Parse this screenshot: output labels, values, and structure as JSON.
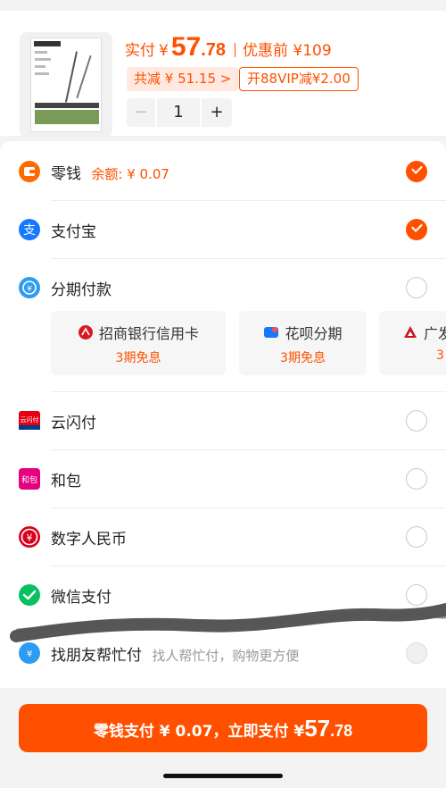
{
  "product": {
    "price_label": "实付",
    "currency": "¥",
    "price_int": "57",
    "price_dec": ".78",
    "original_label": "优惠前 ¥109",
    "discount_tag": "共减 ¥ 51.15 >",
    "vip_tag": "开88VIP减¥2.00",
    "quantity": "1",
    "minus": "−",
    "plus": "+"
  },
  "methods": [
    {
      "name": "零钱",
      "sub": "余额: ¥ 0.07",
      "checked": true,
      "icon": "wallet-icon"
    },
    {
      "name": "支付宝",
      "sub": "",
      "checked": true,
      "icon": "alipay-icon"
    },
    {
      "name": "分期付款",
      "sub": "",
      "checked": false,
      "icon": "installment-icon"
    },
    {
      "name": "云闪付",
      "sub": "",
      "checked": false,
      "icon": "unionpay-icon"
    },
    {
      "name": "和包",
      "sub": "",
      "checked": false,
      "icon": "hebao-icon"
    },
    {
      "name": "数字人民币",
      "sub": "",
      "checked": false,
      "icon": "ecny-icon"
    },
    {
      "name": "微信支付",
      "sub": "",
      "checked": false,
      "icon": "wechat-pay-icon"
    },
    {
      "name": "找朋友帮忙付",
      "sub": "找人帮忙付，购物更方便",
      "checked": false,
      "icon": "friend-pay-icon"
    }
  ],
  "installments": [
    {
      "title": "招商银行信用卡",
      "terms": "3期免息",
      "icon": "cmb-icon"
    },
    {
      "title": "花呗分期",
      "terms": "3期免息",
      "icon": "huabei-icon"
    },
    {
      "title": "广发",
      "terms": "3",
      "icon": "cgb-icon"
    }
  ],
  "pay_button": {
    "prefix": "零钱支付 ¥ 0.07，立即支付 ¥",
    "amount_int": "57",
    "amount_dec": ".78"
  },
  "colors": {
    "accent": "#ff5000",
    "alipay": "#1677ff",
    "wechat": "#07c160"
  }
}
